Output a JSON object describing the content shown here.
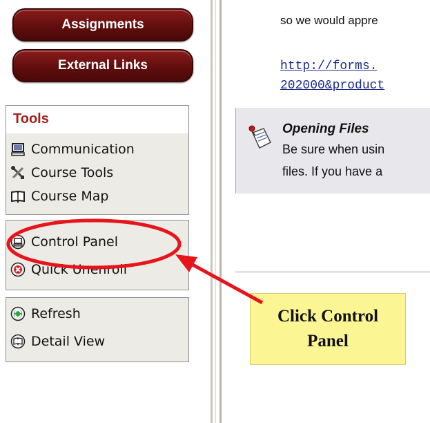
{
  "nav": {
    "assignments_label": "Assignments",
    "external_links_label": "External Links"
  },
  "tools": {
    "title": "Tools",
    "items": [
      {
        "label": "Communication",
        "icon": "computer-icon"
      },
      {
        "label": "Course Tools",
        "icon": "tools-icon"
      },
      {
        "label": "Course Map",
        "icon": "book-icon"
      }
    ]
  },
  "control": {
    "items": [
      {
        "label": "Control Panel",
        "icon": "control-panel-icon"
      },
      {
        "label": "Quick Unenroll",
        "icon": "unenroll-icon"
      }
    ]
  },
  "view": {
    "items": [
      {
        "label": "Refresh",
        "icon": "refresh-icon"
      },
      {
        "label": "Detail View",
        "icon": "detail-view-icon"
      }
    ]
  },
  "content": {
    "line1": "so we would appre",
    "link_line1": "http://forms.",
    "link_line2": "202000&product",
    "files_title": "Opening Files",
    "files_line1": "Be sure when usin",
    "files_line2": "files.  If you have a"
  },
  "callout": {
    "line1": "Click Control",
    "line2": "Panel"
  },
  "colors": {
    "nav_button": "#5e0d0d",
    "tools_title": "#a4211a",
    "annotation": "#e8141c",
    "callout_bg": "#fbf594"
  }
}
